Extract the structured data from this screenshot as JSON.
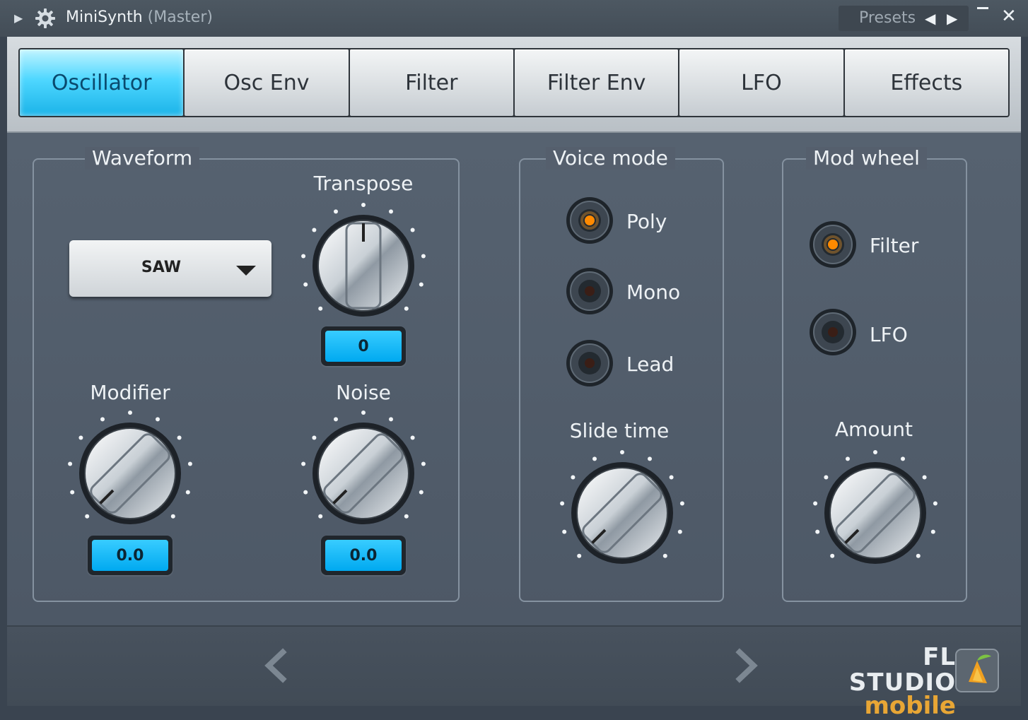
{
  "window": {
    "title": "MiniSynth",
    "subtitle": "(Master)",
    "presets_label": "Presets"
  },
  "tabs": [
    {
      "label": "Oscillator",
      "active": true
    },
    {
      "label": "Osc Env",
      "active": false
    },
    {
      "label": "Filter",
      "active": false
    },
    {
      "label": "Filter Env",
      "active": false
    },
    {
      "label": "LFO",
      "active": false
    },
    {
      "label": "Effects",
      "active": false
    }
  ],
  "waveform": {
    "legend": "Waveform",
    "selected": "SAW",
    "transpose": {
      "label": "Transpose",
      "value": "0"
    },
    "modifier": {
      "label": "Modifier",
      "value": "0.0"
    },
    "noise": {
      "label": "Noise",
      "value": "0.0"
    }
  },
  "voice_mode": {
    "legend": "Voice mode",
    "options": [
      {
        "label": "Poly",
        "selected": true
      },
      {
        "label": "Mono",
        "selected": false
      },
      {
        "label": "Lead",
        "selected": false
      }
    ],
    "slide_time": {
      "label": "Slide time"
    }
  },
  "mod_wheel": {
    "legend": "Mod wheel",
    "options": [
      {
        "label": "Filter",
        "selected": true
      },
      {
        "label": "LFO",
        "selected": false
      }
    ],
    "amount": {
      "label": "Amount"
    }
  },
  "footer": {
    "brand_line1": "FL STUDIO",
    "brand_line2": "mobile"
  },
  "colors": {
    "accent": "#1ab3e8",
    "led_on": "#ff8a00",
    "panel": "#4d5866",
    "brand_orange": "#e8a635"
  }
}
